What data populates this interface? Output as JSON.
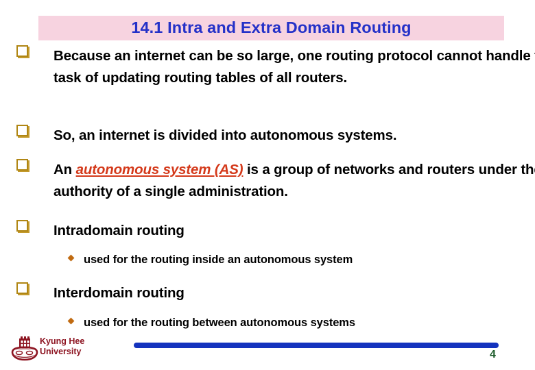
{
  "slide": {
    "title": "14.1 Intra and Extra Domain Routing",
    "page_number": "4",
    "colors": {
      "title_banner_bg": "#f7d3e0",
      "title_text": "#2431c8",
      "bullet_square": "#b08614",
      "bullet_diamond": "#c06a10",
      "accent_red": "#d4391a",
      "footer_bar_blue": "#1433be",
      "footer_university_text": "#8d1421",
      "page_number": "#1d5c2b",
      "background": "#ffffff"
    },
    "bullets": [
      {
        "marker": "hollow-square-bullet",
        "level": 1,
        "text": "Because an internet can be so large, one routing protocol cannot handle the task of updating routing tables of all routers."
      },
      {
        "marker": "hollow-square-bullet",
        "level": 1,
        "text": "So, an internet is divided into autonomous  systems."
      },
      {
        "marker": "hollow-square-bullet",
        "level": 1,
        "text_before": "An ",
        "emphasis": "autonomous system (AS)",
        "text_after": " is a group of networks and routers under the authority of a single administration."
      },
      {
        "marker": "hollow-square-bullet",
        "level": 1,
        "text": "Intradomain routing"
      },
      {
        "marker": "diamond-bullet",
        "level": 2,
        "text": "used for the routing inside an autonomous system"
      },
      {
        "marker": "hollow-square-bullet",
        "level": 1,
        "text": "Interdomain routing"
      },
      {
        "marker": "diamond-bullet",
        "level": 2,
        "text": "used for the routing between autonomous systems"
      }
    ],
    "footer": {
      "university": "Kyung Hee\nUniversity",
      "logo_name": "kyung-hee-university-crest"
    }
  }
}
